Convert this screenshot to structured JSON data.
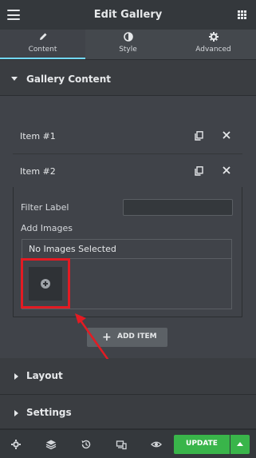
{
  "header": {
    "title": "Edit Gallery",
    "menu_icon": "hamburger-menu-icon",
    "apps_icon": "grid-icon"
  },
  "tabs": [
    {
      "label": "Content",
      "icon": "pencil-icon",
      "active": true
    },
    {
      "label": "Style",
      "icon": "contrast-icon",
      "active": false
    },
    {
      "label": "Advanced",
      "icon": "gear-icon",
      "active": false
    }
  ],
  "sections": {
    "gallery_content": "Gallery Content",
    "layout": "Layout",
    "settings": "Settings"
  },
  "items": [
    {
      "label": "Item #1"
    },
    {
      "label": "Item #2"
    }
  ],
  "item_fields": {
    "filter_label": "Filter Label",
    "filter_value": "",
    "add_images": "Add Images",
    "no_images": "No Images Selected"
  },
  "add_item": {
    "plus": "+",
    "label": "ADD ITEM"
  },
  "footer": {
    "update_label": "UPDATE",
    "icons": [
      "settings-icon",
      "layers-icon",
      "history-icon",
      "responsive-icon",
      "preview-eye-icon"
    ]
  },
  "colors": {
    "accent_tab": "#71d7f7",
    "update_green": "#39b54a",
    "highlight_red": "#e31b23"
  }
}
